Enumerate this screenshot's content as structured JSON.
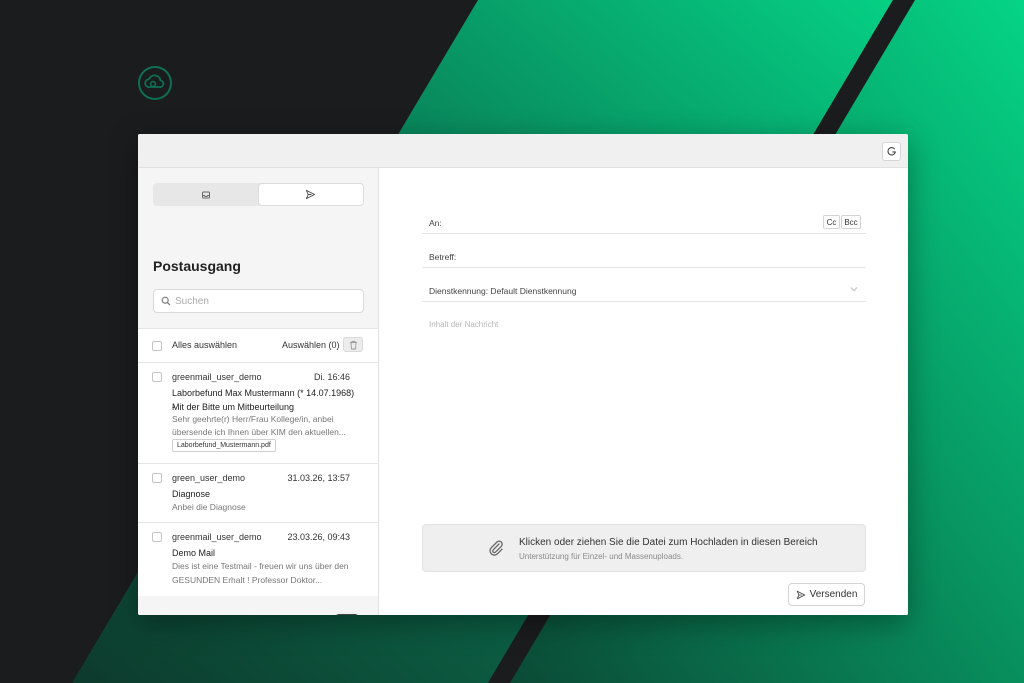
{
  "colors": {
    "background_dark": "#1b1c1e",
    "accent_green": "#05d084",
    "logo_ring": "#0f6f55",
    "panel_light": "#f5f5f5"
  },
  "icons": {
    "logo": "cloud-logo-icon",
    "refresh": "refresh-icon",
    "inbox_tab": "inbox-icon",
    "outbox_tab": "send-icon",
    "search": "search-icon",
    "trash": "trash-icon",
    "compose": "compose-icon",
    "attachment": "paperclip-icon",
    "dropdown": "chevron-down-icon"
  },
  "sidebar": {
    "title": "Postausgang",
    "search_placeholder": "Suchen",
    "select_all_label": "Alles auswählen",
    "select_count_label": "Auswählen (0)",
    "messages": [
      {
        "from": "greenmail_user_demo",
        "date": "Di. 16:46",
        "subject_line1": "Laborbefund Max Mustermann (* 14.07.1968) -",
        "subject_line2": "Mit der Bitte um Mitbeurteilung",
        "preview_line1": "Sehr geehrte(r) Herr/Frau Kollege/in, anbei",
        "preview_line2": "übersende ich Ihnen über KIM den aktuellen...",
        "attachment": "Laborbefund_Mustermann.pdf"
      },
      {
        "from": "green_user_demo",
        "date": "31.03.26, 13:57",
        "subject_line1": "Diagnose",
        "preview_line1": "Anbei die Diagnose"
      },
      {
        "from": "greenmail_user_demo",
        "date": "23.03.26, 09:43",
        "subject_line1": "Demo Mail",
        "preview_line1": "Dies ist eine Testmail - freuen wir uns über den",
        "preview_line2": "GESUNDEN Erhalt ! Professor Doktor..."
      }
    ]
  },
  "compose": {
    "to_label": "An:",
    "cc_label": "Cc",
    "bcc_label": "Bcc",
    "subject_label": "Betreff:",
    "identity_label": "Dienstkennung: Default Dienstkennung",
    "body_placeholder": "Inhalt der Nachricht",
    "upload_title": "Klicken oder ziehen Sie die Datei zum Hochladen in diesen Bereich",
    "upload_subtitle": "Unterstützung für Einzel- und Massenuploads.",
    "send_label": "Versenden"
  }
}
